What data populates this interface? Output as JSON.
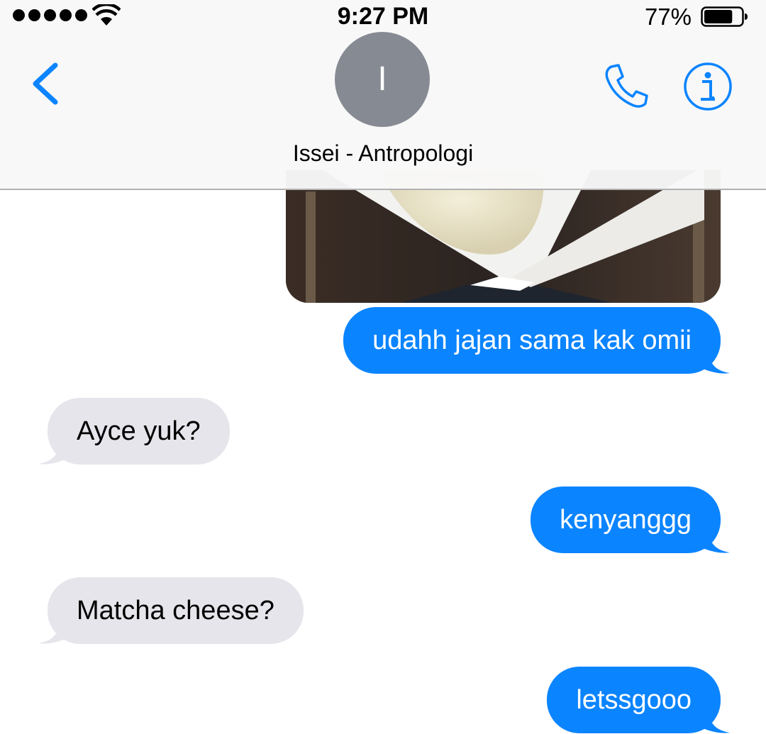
{
  "status_bar": {
    "time": "9:27 PM",
    "battery_percent": "77%",
    "signal_bars": 5,
    "wifi_icon": "wifi-icon",
    "battery_icon": "battery-icon",
    "battery_level": 0.77
  },
  "header": {
    "avatar_initial": "I",
    "contact_name": "Issei - Antropologi",
    "back_icon": "chevron-left-icon",
    "call_icon": "phone-icon",
    "info_icon": "info-icon"
  },
  "messages": [
    {
      "direction": "outgoing",
      "type": "photo"
    },
    {
      "direction": "outgoing",
      "text": "udahh jajan sama kak omii"
    },
    {
      "direction": "incoming",
      "text": "Ayce yuk?"
    },
    {
      "direction": "outgoing",
      "text": "kenyanggg"
    },
    {
      "direction": "incoming",
      "text": "Matcha cheese?"
    },
    {
      "direction": "outgoing",
      "text": "letssgooo"
    }
  ],
  "colors": {
    "accent": "#0b84ff",
    "outgoing_bubble": "#0b84ff",
    "incoming_bubble": "#e6e5eb",
    "avatar": "#868a93"
  }
}
